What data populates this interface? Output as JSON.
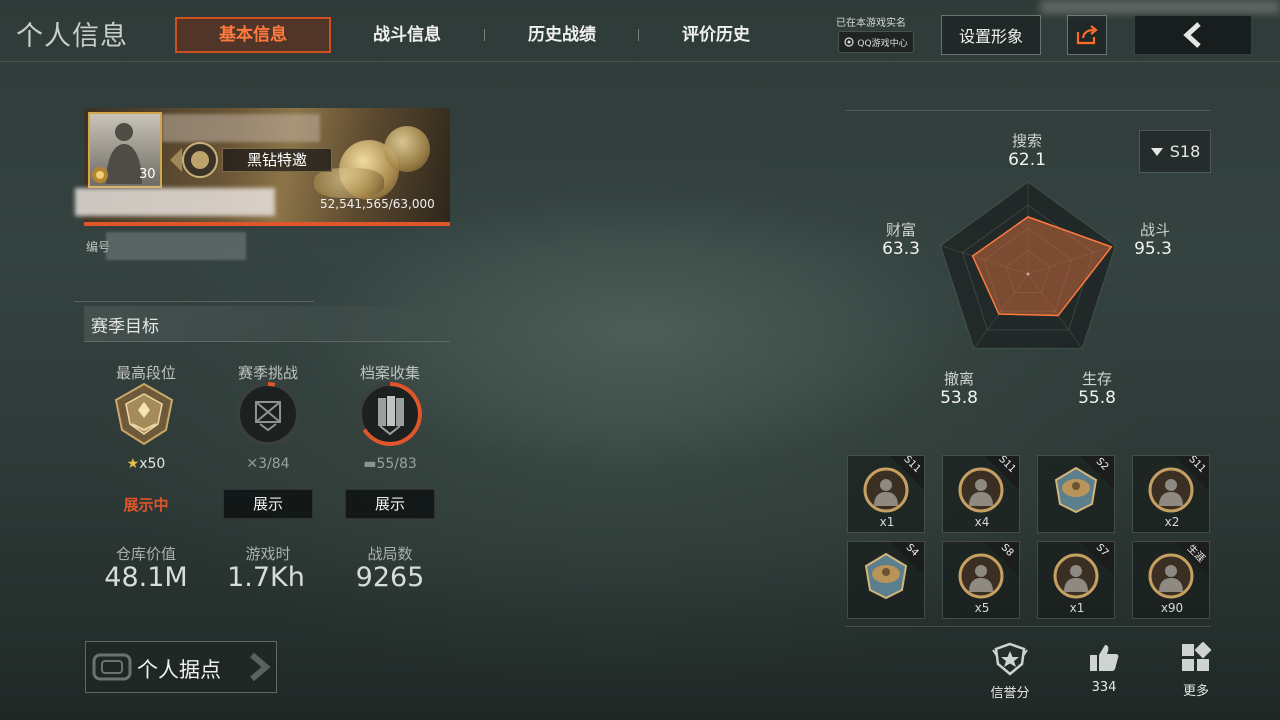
{
  "header": {
    "title": "个人信息",
    "tabs": [
      {
        "label": "基本信息",
        "active": true
      },
      {
        "label": "战斗信息",
        "active": false
      },
      {
        "label": "历史战绩",
        "active": false
      },
      {
        "label": "评价历史",
        "active": false
      }
    ],
    "realname_note": "已在本游戏实名",
    "qq_badge": "QQ游戏中心",
    "set_avatar": "设置形象"
  },
  "profile": {
    "level": "30",
    "rank_name": "黑钻特邀",
    "exp_text": "52,541,565/63,000",
    "exp_fraction": 1.0,
    "id_label": "编号"
  },
  "season_goals": {
    "title": "赛季目标",
    "items": [
      {
        "label": "最高段位",
        "count": "x50",
        "state": "展示中"
      },
      {
        "label": "赛季挑战",
        "count": "3/84",
        "button": "展示",
        "progress": 0.036
      },
      {
        "label": "档案收集",
        "count": "55/83",
        "button": "展示",
        "progress": 0.663
      }
    ]
  },
  "stats": [
    {
      "label": "仓库价值",
      "value": "48.1M"
    },
    {
      "label": "游戏时",
      "value": "1.7Kh"
    },
    {
      "label": "战局数",
      "value": "9265"
    }
  ],
  "base_button": "个人据点",
  "season_select": "S18",
  "radar": {
    "axes": [
      {
        "name": "搜索",
        "value": "62.1"
      },
      {
        "name": "战斗",
        "value": "95.3"
      },
      {
        "name": "生存",
        "value": "55.8"
      },
      {
        "name": "撤离",
        "value": "53.8"
      },
      {
        "name": "财富",
        "value": "63.3"
      }
    ],
    "max": 100,
    "fill_color": "#c8683a",
    "stroke_color": "#ff7a3d"
  },
  "badges": [
    {
      "season": "S11",
      "count": "x1",
      "icon": "portrait-medal-icon"
    },
    {
      "season": "S11",
      "count": "x4",
      "icon": "portrait-medal-icon"
    },
    {
      "season": "S2",
      "count": "",
      "icon": "eagle-shield-medal-icon"
    },
    {
      "season": "S11",
      "count": "x2",
      "icon": "portrait-medal-icon"
    },
    {
      "season": "S4",
      "count": "",
      "icon": "eagle-shield-medal-icon"
    },
    {
      "season": "S8",
      "count": "x5",
      "icon": "portrait-medal-icon"
    },
    {
      "season": "S7",
      "count": "x1",
      "icon": "portrait-medal-icon"
    },
    {
      "season": "生涯",
      "count": "x90",
      "icon": "portrait-medal-icon"
    }
  ],
  "actions": [
    {
      "label": "信誉分",
      "icon": "shield-star-icon"
    },
    {
      "label": "334",
      "icon": "thumbs-up-icon"
    },
    {
      "label": "更多",
      "icon": "grid-more-icon"
    }
  ]
}
